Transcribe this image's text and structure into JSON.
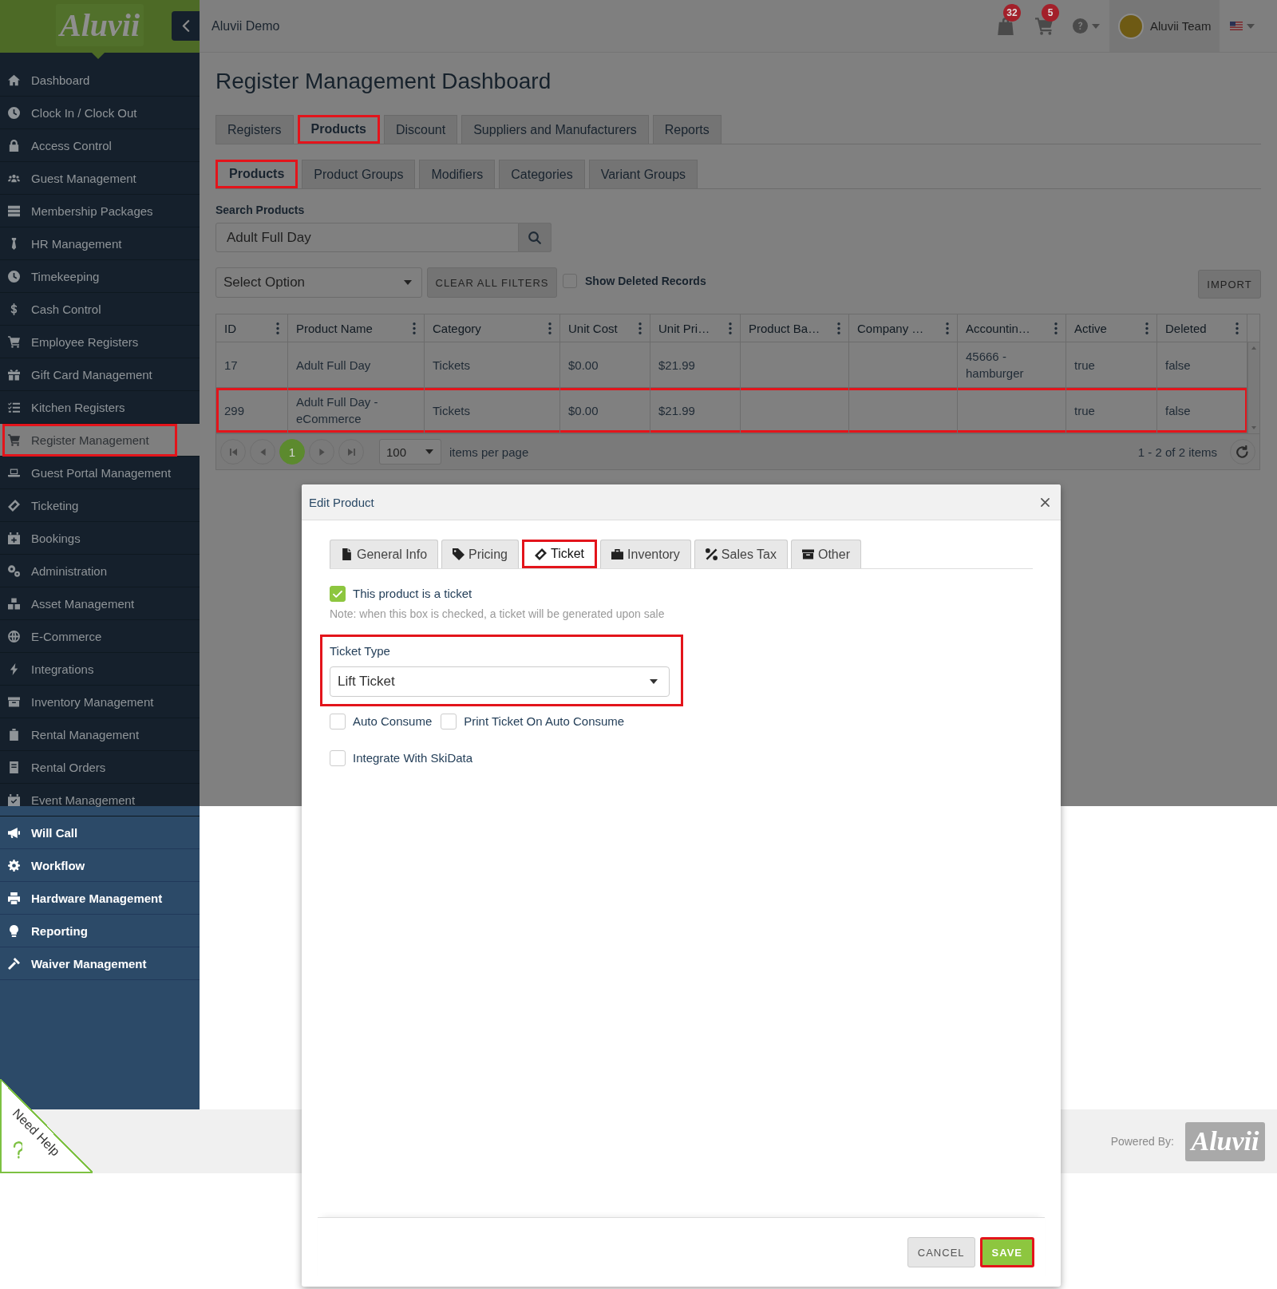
{
  "app": {
    "logo": "Aluvii",
    "title": "Aluvii Demo"
  },
  "header": {
    "badges": [
      {
        "kind": "bag",
        "count": "32"
      },
      {
        "kind": "cart",
        "count": "5"
      }
    ],
    "user_name": "Aluvii Team"
  },
  "sidebar": {
    "items": [
      {
        "label": "Dashboard",
        "selected": false,
        "highlighted": false
      },
      {
        "label": "Clock In / Clock Out",
        "selected": false,
        "highlighted": false
      },
      {
        "label": "Access Control",
        "selected": false,
        "highlighted": false
      },
      {
        "label": "Guest Management",
        "selected": false,
        "highlighted": false
      },
      {
        "label": "Membership Packages",
        "selected": false,
        "highlighted": false
      },
      {
        "label": "HR Management",
        "selected": false,
        "highlighted": false
      },
      {
        "label": "Timekeeping",
        "selected": false,
        "highlighted": false
      },
      {
        "label": "Cash Control",
        "selected": false,
        "highlighted": false
      },
      {
        "label": "Employee Registers",
        "selected": false,
        "highlighted": false
      },
      {
        "label": "Gift Card Management",
        "selected": false,
        "highlighted": false
      },
      {
        "label": "Kitchen Registers",
        "selected": false,
        "highlighted": false
      },
      {
        "label": "Register Management",
        "selected": true,
        "highlighted": true
      },
      {
        "label": "Guest Portal Management",
        "selected": false,
        "highlighted": false
      },
      {
        "label": "Ticketing",
        "selected": false,
        "highlighted": false
      },
      {
        "label": "Bookings",
        "selected": false,
        "highlighted": false
      },
      {
        "label": "Administration",
        "selected": false,
        "highlighted": false
      },
      {
        "label": "Asset Management",
        "selected": false,
        "highlighted": false
      },
      {
        "label": "E-Commerce",
        "selected": false,
        "highlighted": false
      },
      {
        "label": "Integrations",
        "selected": false,
        "highlighted": false
      },
      {
        "label": "Inventory Management",
        "selected": false,
        "highlighted": false
      },
      {
        "label": "Rental Management",
        "selected": false,
        "highlighted": false
      },
      {
        "label": "Rental Orders",
        "selected": false,
        "highlighted": false
      },
      {
        "label": "Event Management",
        "selected": false,
        "highlighted": false
      },
      {
        "label": "Will Call",
        "selected": false,
        "highlighted": false
      },
      {
        "label": "Workflow",
        "selected": false,
        "highlighted": false
      },
      {
        "label": "Hardware Management",
        "selected": false,
        "highlighted": false
      },
      {
        "label": "Reporting",
        "selected": false,
        "highlighted": false
      },
      {
        "label": "Waiver Management",
        "selected": false,
        "highlighted": false
      }
    ]
  },
  "page": {
    "title": "Register Management Dashboard",
    "tabs": [
      {
        "label": "Registers",
        "selected": false,
        "highlighted": false
      },
      {
        "label": "Products",
        "selected": true,
        "highlighted": true
      },
      {
        "label": "Discount",
        "selected": false,
        "highlighted": false
      },
      {
        "label": "Suppliers and Manufacturers",
        "selected": false,
        "highlighted": false
      },
      {
        "label": "Reports",
        "selected": false,
        "highlighted": false
      }
    ],
    "subtabs": [
      {
        "label": "Products",
        "selected": true,
        "highlighted": true
      },
      {
        "label": "Product Groups",
        "selected": false,
        "highlighted": false
      },
      {
        "label": "Modifiers",
        "selected": false,
        "highlighted": false
      },
      {
        "label": "Categories",
        "selected": false,
        "highlighted": false
      },
      {
        "label": "Variant Groups",
        "selected": false,
        "highlighted": false
      }
    ],
    "search": {
      "label": "Search Products",
      "value": "Adult Full Day"
    },
    "filter_select": {
      "value": "Select Option"
    },
    "clear_button": "CLEAR ALL FILTERS",
    "show_deleted": {
      "label": "Show Deleted Records",
      "checked": false
    },
    "import_button": "IMPORT",
    "table": {
      "columns": [
        "ID",
        "Product Name",
        "Category",
        "Unit Cost",
        "Unit Pri…",
        "Product Ba…",
        "Company …",
        "Accountin…",
        "Active",
        "Deleted"
      ],
      "rows": [
        {
          "cells": [
            "17",
            "Adult Full Day",
            "Tickets",
            "$0.00",
            "$21.99",
            null,
            null,
            "45666 - hamburger",
            "true",
            "false"
          ],
          "highlighted": false
        },
        {
          "cells": [
            "299",
            "Adult Full Day - eCommerce",
            "Tickets",
            "$0.00",
            "$21.99",
            null,
            null,
            null,
            "true",
            "false"
          ],
          "highlighted": true
        }
      ]
    },
    "pager": {
      "pages": [
        {
          "label": "1",
          "selected": true
        }
      ],
      "page_size": "100",
      "page_size_label": "items per page",
      "summary": "1 - 2 of 2 items"
    }
  },
  "modal": {
    "title": "Edit Product",
    "tabs": [
      {
        "label": "General Info",
        "selected": false,
        "highlighted": false
      },
      {
        "label": "Pricing",
        "selected": false,
        "highlighted": false
      },
      {
        "label": "Ticket",
        "selected": true,
        "highlighted": true
      },
      {
        "label": "Inventory",
        "selected": false,
        "highlighted": false
      },
      {
        "label": "Sales Tax",
        "selected": false,
        "highlighted": false
      },
      {
        "label": "Other",
        "selected": false,
        "highlighted": false
      }
    ],
    "ticket_checkbox": {
      "label": "This product is a ticket",
      "checked": true
    },
    "note": "Note: when this box is checked, a ticket will be generated upon sale",
    "ticket_type": {
      "label": "Ticket Type",
      "value": "Lift Ticket",
      "highlighted": true
    },
    "option_rows": [
      [
        {
          "label": "Auto Consume",
          "checked": false
        },
        {
          "label": "Print Ticket On Auto Consume",
          "checked": false
        }
      ],
      [
        {
          "label": "Integrate With SkiData",
          "checked": false
        }
      ]
    ],
    "buttons": [
      {
        "label": "CANCEL",
        "kind": "secondary",
        "highlighted": false
      },
      {
        "label": "SAVE",
        "kind": "primary",
        "highlighted": true
      }
    ]
  },
  "footer": {
    "powered_by": "Powered By:",
    "logo": "Aluvii"
  },
  "help": {
    "label": "Need Help"
  }
}
